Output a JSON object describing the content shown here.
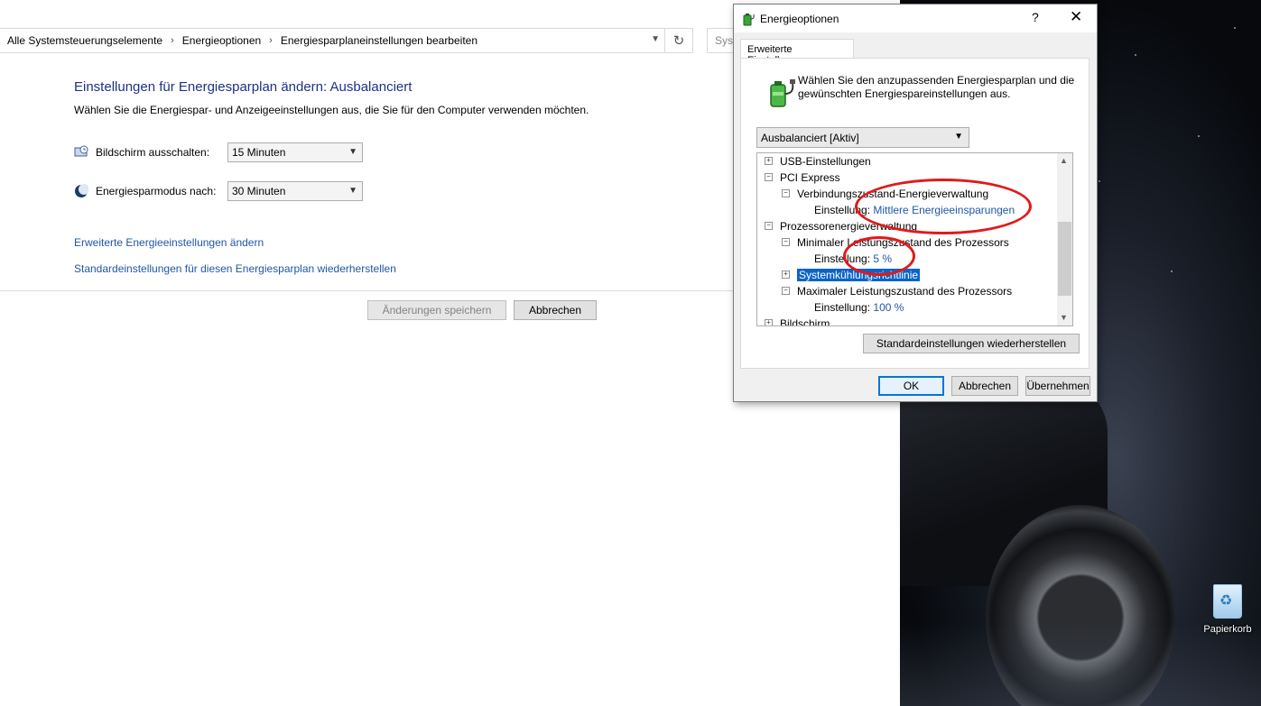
{
  "control_panel": {
    "breadcrumb": [
      "Alle Systemsteuerungselemente",
      "Energieoptionen",
      "Energiesparplaneinstellungen bearbeiten"
    ],
    "search_placeholder": "Syst",
    "title": "Einstellungen für Energiesparplan ändern: Ausbalanciert",
    "subtitle": "Wählen Sie die Energiespar- und Anzeigeeinstellungen aus, die Sie für den Computer verwenden möchten.",
    "display_off_label": "Bildschirm ausschalten:",
    "display_off_value": "15 Minuten",
    "sleep_label": "Energiesparmodus nach:",
    "sleep_value": "30 Minuten",
    "link_advanced": "Erweiterte Energieeinstellungen ändern",
    "link_restore": "Standardeinstellungen für diesen Energiesparplan wiederherstellen",
    "save_button": "Änderungen speichern",
    "cancel_button": "Abbrechen"
  },
  "dialog": {
    "title": "Energieoptionen",
    "help": "?",
    "close": "✕",
    "tab": "Erweiterte Einstellungen",
    "description": "Wählen Sie den anzupassenden Energiesparplan und die gewünschten Energiespareinstellungen aus.",
    "plan": "Ausbalanciert [Aktiv]",
    "tree": {
      "usb": "USB-Einstellungen",
      "pci": "PCI Express",
      "link_state": "Verbindungszustand-Energieverwaltung",
      "setting_label": "Einstellung:",
      "link_state_value": "Mittlere Energieeinsparungen",
      "cpu": "Prozessorenergieverwaltung",
      "min_state": "Minimaler Leistungszustand des Prozessors",
      "min_state_value": "5 %",
      "cooling": "Systemkühlungsrichtlinie",
      "max_state": "Maximaler Leistungszustand des Prozessors",
      "max_state_value": "100 %",
      "display": "Bildschirm"
    },
    "restore_defaults": "Standardeinstellungen wiederherstellen",
    "ok": "OK",
    "cancel": "Abbrechen",
    "apply": "Übernehmen"
  },
  "desktop": {
    "recycle_bin": "Papierkorb"
  },
  "colors": {
    "accent": "#0078d7",
    "link": "#1e57a8",
    "title": "#1e3287",
    "annotation": "#e01a1a",
    "selection": "#0a64c8"
  }
}
